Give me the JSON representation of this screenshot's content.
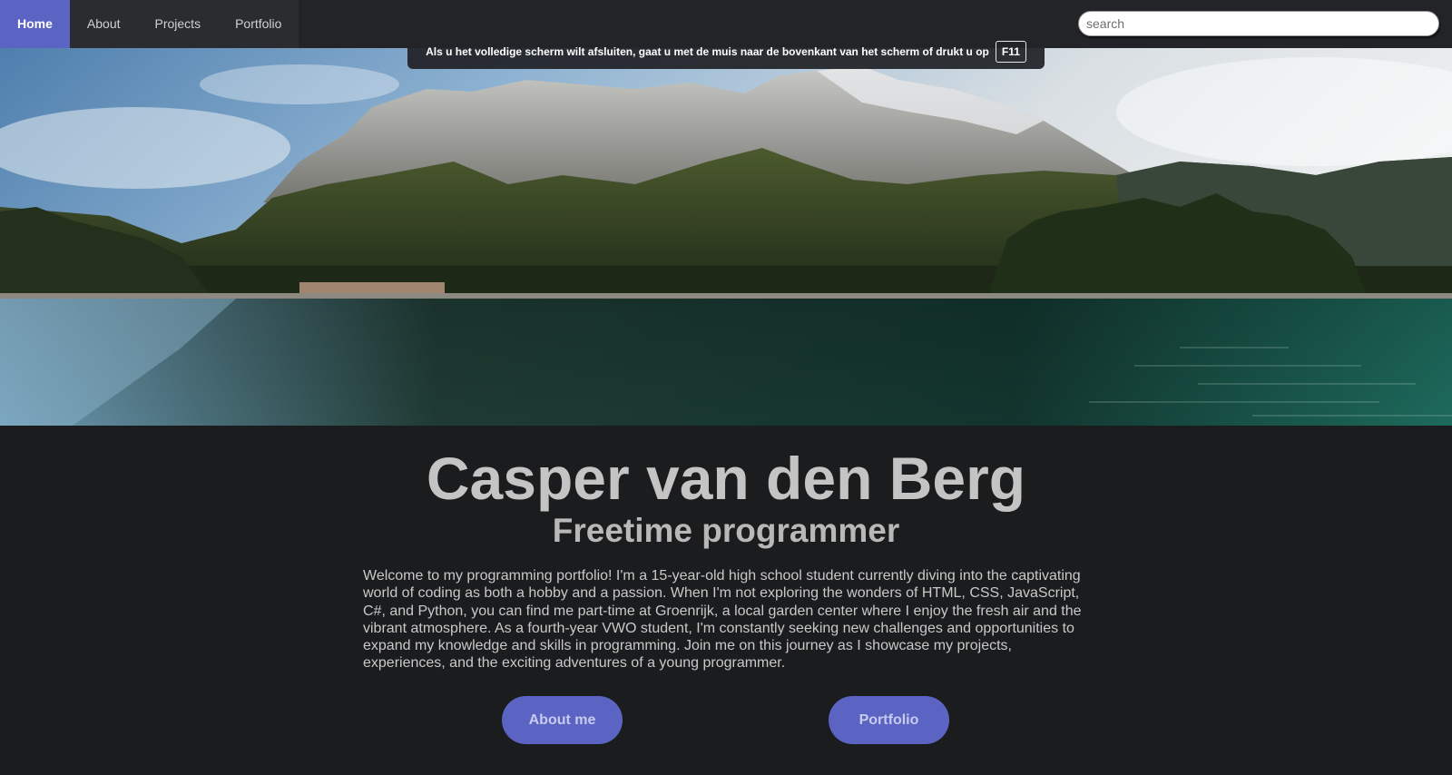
{
  "nav": {
    "items": [
      {
        "label": "Home",
        "active": true
      },
      {
        "label": "About",
        "active": false
      },
      {
        "label": "Projects",
        "active": false
      },
      {
        "label": "Portfolio",
        "active": false
      }
    ],
    "search_placeholder": "search"
  },
  "fullscreen_notice": {
    "text": "Als u het volledige scherm wilt afsluiten, gaat u met de muis naar de bovenkant van het scherm of drukt u op",
    "key": "F11"
  },
  "hero": {
    "image_icon": "mountain-lake-landscape"
  },
  "main": {
    "name": "Casper van den Berg",
    "role": "Freetime programmer",
    "intro": "Welcome to my programming portfolio! I'm a 15-year-old high school student currently diving into the captivating world of coding as both a hobby and a passion. When I'm not exploring the wonders of HTML, CSS, JavaScript, C#, and Python, you can find me part-time at Groenrijk, a local garden center where I enjoy the fresh air and the vibrant atmosphere. As a fourth-year VWO student, I'm constantly seeking new challenges and opportunities to expand my knowledge and skills in programming. Join me on this journey as I showcase my projects, experiences, and the exciting adventures of a young programmer.",
    "buttons": {
      "about": "About me",
      "portfolio": "Portfolio"
    }
  },
  "colors": {
    "accent": "#5b64c2",
    "background": "#1b1c1e",
    "navbar": "#222427"
  }
}
